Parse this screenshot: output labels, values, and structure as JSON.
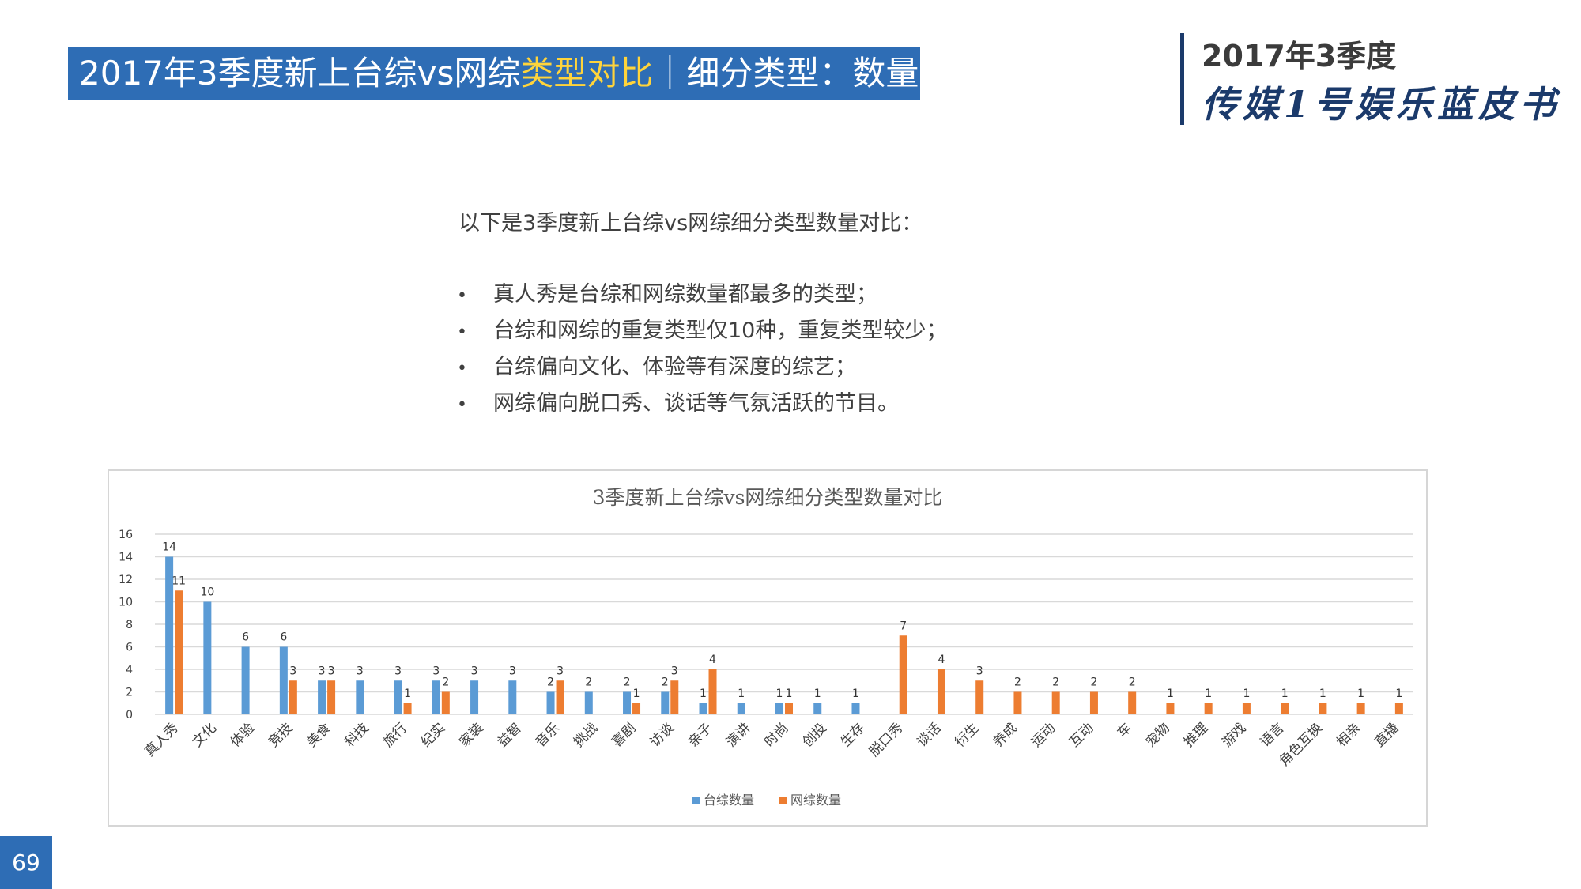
{
  "header": {
    "title_part1": "2017年3季度新上台综vs网综",
    "title_highlight": "类型对比",
    "title_part2": "｜细分类型：数量"
  },
  "brand": {
    "year": "2017年3季度",
    "name": "传媒1号娱乐蓝皮书"
  },
  "intro": "以下是3季度新上台综vs网综细分类型数量对比：",
  "bullets": [
    "真人秀是台综和网综数量都最多的类型；",
    "台综和网综的重复类型仅10种，重复类型较少；",
    "台综偏向文化、体验等有深度的综艺；",
    "网综偏向脱口秀、谈话等气氛活跃的节目。"
  ],
  "bullet_glyph": "•",
  "page_number": "69",
  "colors": {
    "title_bg": "#2e6db5",
    "highlight": "#ffd43b",
    "tv_series": "#5b9bd5",
    "web_series": "#ed7d31"
  },
  "chart_data": {
    "type": "bar",
    "title": "3季度新上台综vs网综细分类型数量对比",
    "categories": [
      "真人秀",
      "文化",
      "体验",
      "竞技",
      "美食",
      "科技",
      "旅行",
      "纪实",
      "家装",
      "益智",
      "音乐",
      "挑战",
      "喜剧",
      "访谈",
      "亲子",
      "演讲",
      "时尚",
      "创投",
      "生存",
      "脱口秀",
      "谈话",
      "衍生",
      "养成",
      "运动",
      "互动",
      "车",
      "宠物",
      "推理",
      "游戏",
      "语言",
      "角色互换",
      "相亲",
      "直播"
    ],
    "series": [
      {
        "name": "台综数量",
        "color": "#5b9bd5",
        "values": [
          14,
          10,
          6,
          6,
          3,
          3,
          3,
          3,
          3,
          3,
          2,
          2,
          2,
          2,
          1,
          1,
          1,
          1,
          1,
          null,
          null,
          null,
          null,
          null,
          null,
          null,
          null,
          null,
          null,
          null,
          null,
          null,
          null
        ]
      },
      {
        "name": "网综数量",
        "color": "#ed7d31",
        "values": [
          11,
          null,
          null,
          3,
          3,
          null,
          1,
          2,
          null,
          null,
          3,
          null,
          1,
          3,
          4,
          null,
          1,
          null,
          null,
          7,
          4,
          3,
          2,
          2,
          2,
          2,
          1,
          1,
          1,
          1,
          1,
          1,
          1
        ]
      }
    ],
    "ylim": [
      0,
      16
    ],
    "yticks": [
      0,
      2,
      4,
      6,
      8,
      10,
      12,
      14,
      16
    ],
    "grid": true,
    "legend": "bottom"
  }
}
